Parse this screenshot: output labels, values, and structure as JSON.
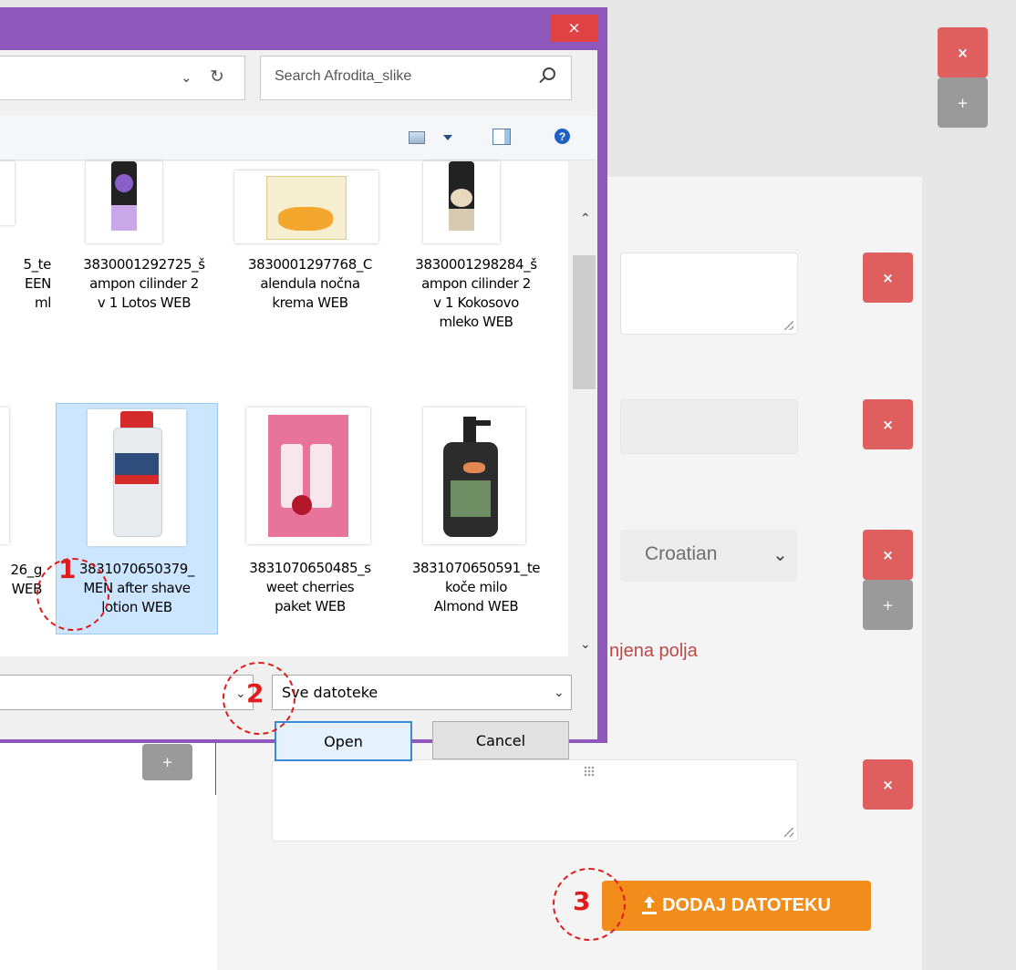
{
  "page": {
    "required_text": "njena polja",
    "language_select": "Croatian",
    "upload_button": "DODAJ DATOTEKU",
    "x_label": "×",
    "plus_label": "+"
  },
  "dialog": {
    "close_label": "×",
    "search_placeholder": "Search Afrodita_slike",
    "filetype_value": "Sve datoteke",
    "open_label": "Open",
    "cancel_label": "Cancel",
    "files_row1": [
      {
        "label": "5_te\nEEN\nml"
      },
      {
        "label": "3830001292725_š\nampon cilinder 2\nv 1 Lotos WEB"
      },
      {
        "label": "3830001297768_C\nalendula nočna\nkrema WEB"
      },
      {
        "label": "3830001298284_š\nampon cilinder 2\nv 1 Kokosovo\nmleko WEB"
      }
    ],
    "files_row2": [
      {
        "label": "26_g\nWEB"
      },
      {
        "label": "3831070650379_\nMEN after shave\nlotion WEB"
      },
      {
        "label": "3831070650485_s\nweet cherries\npaket WEB"
      },
      {
        "label": "3831070650591_te\nkoče milo\nAlmond WEB"
      }
    ]
  },
  "annotations": [
    "1",
    "2",
    "3"
  ]
}
